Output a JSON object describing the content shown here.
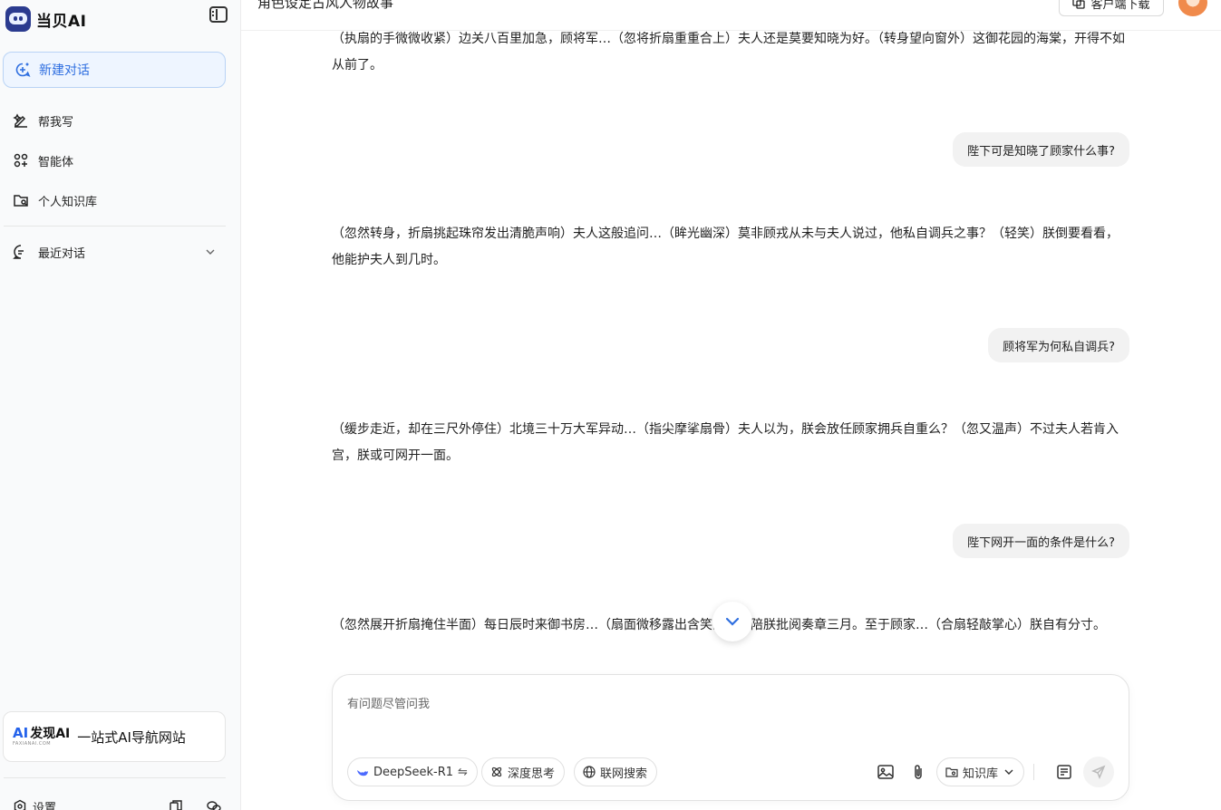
{
  "app": {
    "name": "当贝AI"
  },
  "sidebar": {
    "new_chat_label": "新建对话",
    "items": [
      {
        "label": "帮我写"
      },
      {
        "label": "智能体"
      },
      {
        "label": "个人知识库"
      }
    ],
    "recent_label": "最近对话",
    "promo": {
      "brand": "发现AI",
      "brand_ai": "AI",
      "brand_zh": "发现AI",
      "brand_sub": "FAXIANAI.COM",
      "tagline": "一站式AI导航网站"
    },
    "settings_label": "设置"
  },
  "header": {
    "title": "角色设定古风人物故事",
    "download_label": "客户端下载"
  },
  "messages": [
    {
      "role": "assistant",
      "text": "（执扇的手微微收紧）边关八百里加急，顾将军…（忽将折扇重重合上）夫人还是莫要知晓为好。（转身望向窗外）这御花园的海棠，开得不如从前了。"
    },
    {
      "role": "user",
      "text": "陛下可是知晓了顾家什么事?"
    },
    {
      "role": "assistant",
      "text": "（忽然转身，折扇挑起珠帘发出清脆声响）夫人这般追问…（眸光幽深）莫非顾戎从未与夫人说过，他私自调兵之事？（轻笑）朕倒要看看，他能护夫人到几时。"
    },
    {
      "role": "user",
      "text": "顾将军为何私自调兵?"
    },
    {
      "role": "assistant",
      "text": "（缓步走近，却在三尺外停住）北境三十万大军异动…（指尖摩挲扇骨）夫人以为，朕会放任顾家拥兵自重么？（忽又温声）不过夫人若肯入宫，朕或可网开一面。"
    },
    {
      "role": "user",
      "text": "陛下网开一面的条件是什么?"
    },
    {
      "role": "assistant",
      "text": "（忽然展开折扇掩住半面）每日辰时来御书房…（扇面微移露出含笑的眼）陪朕批阅奏章三月。至于顾家…（合扇轻敲掌心）朕自有分寸。"
    }
  ],
  "composer": {
    "placeholder": "有问题尽管问我",
    "model_label": "DeepSeek-R1",
    "model_switch_glyph": "⇋",
    "deep_think_label": "深度思考",
    "web_search_label": "联网搜索",
    "knowledge_label": "知识库"
  },
  "colors": {
    "accent": "#2f6fe0",
    "new_chat_bg": "#eef5ff",
    "bubble_bg": "#f2f2f2"
  }
}
